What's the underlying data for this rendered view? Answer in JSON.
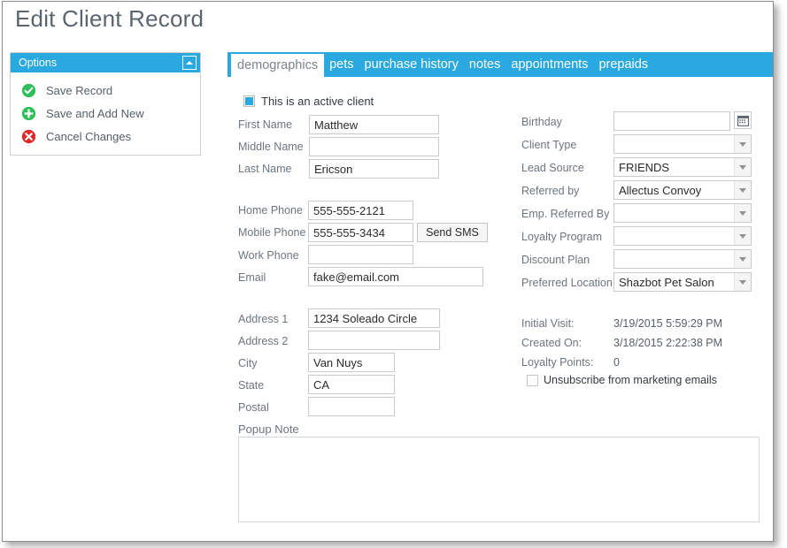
{
  "page": {
    "title": "Edit Client Record"
  },
  "options_panel": {
    "header_title": "Options",
    "collapse_icon": "chevron-up-icon",
    "items": [
      {
        "label": "Save Record",
        "icon": "check-circle-icon",
        "color": "#2fbf59"
      },
      {
        "label": "Save and Add New",
        "icon": "plus-circle-icon",
        "color": "#2fbf59"
      },
      {
        "label": "Cancel Changes",
        "icon": "cancel-circle-icon",
        "color": "#e02b2b"
      }
    ]
  },
  "tabs": [
    {
      "label": "demographics",
      "active": true
    },
    {
      "label": "pets",
      "active": false
    },
    {
      "label": "purchase history",
      "active": false
    },
    {
      "label": "notes",
      "active": false
    },
    {
      "label": "appointments",
      "active": false
    },
    {
      "label": "prepaids",
      "active": false
    }
  ],
  "form": {
    "active_client": {
      "label": "This is an active client",
      "checked": true
    },
    "name": {
      "first_label": "First Name",
      "first_value": "Matthew",
      "middle_label": "Middle Name",
      "middle_value": "",
      "last_label": "Last Name",
      "last_value": "Ericson"
    },
    "contact": {
      "home_phone_label": "Home Phone",
      "home_phone_value": "555-555-2121",
      "mobile_phone_label": "Mobile Phone",
      "mobile_phone_value": "555-555-3434",
      "send_sms_label": "Send SMS",
      "work_phone_label": "Work Phone",
      "work_phone_value": "",
      "email_label": "Email",
      "email_value": "fake@email.com"
    },
    "address": {
      "address1_label": "Address 1",
      "address1_value": "1234 Soleado Circle",
      "address2_label": "Address 2",
      "address2_value": "",
      "city_label": "City",
      "city_value": "Van Nuys",
      "state_label": "State",
      "state_value": "CA",
      "postal_label": "Postal",
      "postal_value": ""
    },
    "popup_note": {
      "label": "Popup Note",
      "value": ""
    },
    "right": {
      "birthday_label": "Birthday",
      "birthday_value": "",
      "birthday_icon": "calendar-icon",
      "client_type_label": "Client Type",
      "client_type_value": "",
      "lead_source_label": "Lead Source",
      "lead_source_value": "FRIENDS",
      "referred_by_label": "Referred by",
      "referred_by_value": "Allectus Convoy",
      "emp_referred_by_label": "Emp. Referred By",
      "emp_referred_by_value": "",
      "loyalty_program_label": "Loyalty Program",
      "loyalty_program_value": "",
      "discount_plan_label": "Discount Plan",
      "discount_plan_value": "",
      "preferred_location_label": "Preferred Location",
      "preferred_location_value": "Shazbot Pet Salon"
    },
    "info": {
      "initial_visit_label": "Initial Visit:",
      "initial_visit_value": "3/19/2015 5:59:29 PM",
      "created_on_label": "Created On:",
      "created_on_value": "3/18/2015 2:22:38 PM",
      "loyalty_points_label": "Loyalty Points:",
      "loyalty_points_value": "0",
      "unsubscribe_label": "Unsubscribe from marketing emails",
      "unsubscribe_checked": false
    }
  },
  "colors": {
    "accent_blue": "#29a9e0",
    "label_gray": "#6c757d",
    "green": "#2fbf59",
    "red": "#e02b2b"
  }
}
